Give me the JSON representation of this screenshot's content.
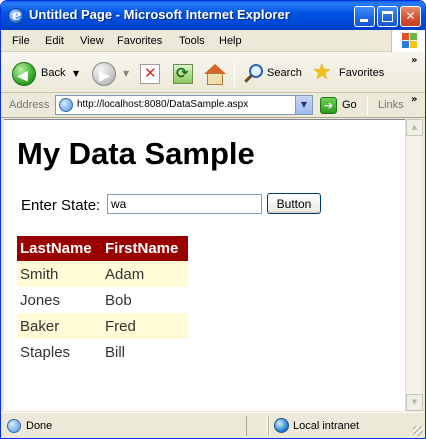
{
  "window": {
    "title": "Untitled Page - Microsoft Internet Explorer",
    "minimize_icon": "minimize-icon",
    "maximize_icon": "maximize-icon",
    "close_icon": "close-icon",
    "close_glyph": "✕"
  },
  "menu": {
    "items": [
      "File",
      "Edit",
      "View",
      "Favorites",
      "Tools",
      "Help"
    ]
  },
  "toolbar": {
    "back_label": "Back",
    "search_label": "Search",
    "favorites_label": "Favorites",
    "overflow_glyph": "»"
  },
  "address": {
    "label": "Address",
    "url": "http://localhost:8080/DataSample.aspx",
    "go_label": "Go",
    "links_label": "Links"
  },
  "page": {
    "heading": "My Data Sample",
    "state_label": "Enter State:",
    "state_value": "wa",
    "button_label": "Button",
    "table": {
      "columns": [
        "LastName",
        "FirstName"
      ],
      "rows": [
        [
          "Smith",
          "Adam"
        ],
        [
          "Jones",
          "Bob"
        ],
        [
          "Baker",
          "Fred"
        ],
        [
          "Staples",
          "Bill"
        ]
      ]
    }
  },
  "status": {
    "text": "Done",
    "zone": "Local intranet"
  },
  "colors": {
    "header_bg": "#990000",
    "alt_row_bg": "#fffbd6",
    "titlebar_blue": "#0055e6"
  }
}
